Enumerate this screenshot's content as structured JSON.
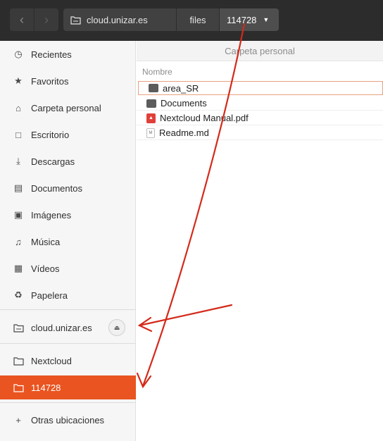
{
  "header": {
    "back_icon": "chevron-left-icon",
    "forward_icon": "chevron-right-icon",
    "breadcrumbs": [
      "cloud.unizar.es",
      "files",
      "114728"
    ],
    "dropdown_icon": "caret-down-icon"
  },
  "sidebar": {
    "items": [
      {
        "label": "Recientes",
        "icon": "clock-icon"
      },
      {
        "label": "Favoritos",
        "icon": "star-icon"
      },
      {
        "label": "Carpeta personal",
        "icon": "home-icon"
      },
      {
        "label": "Escritorio",
        "icon": "desktop-icon"
      },
      {
        "label": "Descargas",
        "icon": "download-icon"
      },
      {
        "label": "Documentos",
        "icon": "document-icon"
      },
      {
        "label": "Imágenes",
        "icon": "image-icon"
      },
      {
        "label": "Música",
        "icon": "music-icon"
      },
      {
        "label": "Vídeos",
        "icon": "video-icon"
      },
      {
        "label": "Papelera",
        "icon": "trash-icon"
      }
    ],
    "mounts": [
      {
        "label": "cloud.unizar.es",
        "icon": "network-folder-icon",
        "eject_icon": "eject-icon"
      },
      {
        "label": "Nextcloud",
        "icon": "folder-icon"
      },
      {
        "label": "114728",
        "icon": "folder-icon",
        "selected": true
      }
    ],
    "other": {
      "label": "Otras ubicaciones",
      "icon": "plus-icon"
    }
  },
  "main": {
    "title": "Carpeta personal",
    "column_name": "Nombre",
    "files": [
      {
        "name": "area_SR",
        "type": "folder"
      },
      {
        "name": "Documents",
        "type": "folder"
      },
      {
        "name": "Nextcloud Manual.pdf",
        "type": "pdf"
      },
      {
        "name": "Readme.md",
        "type": "markdown"
      }
    ]
  },
  "colors": {
    "accent": "#e95420",
    "header_bg": "#2c2c2c",
    "annotation_arrow": "#d42a1a"
  }
}
